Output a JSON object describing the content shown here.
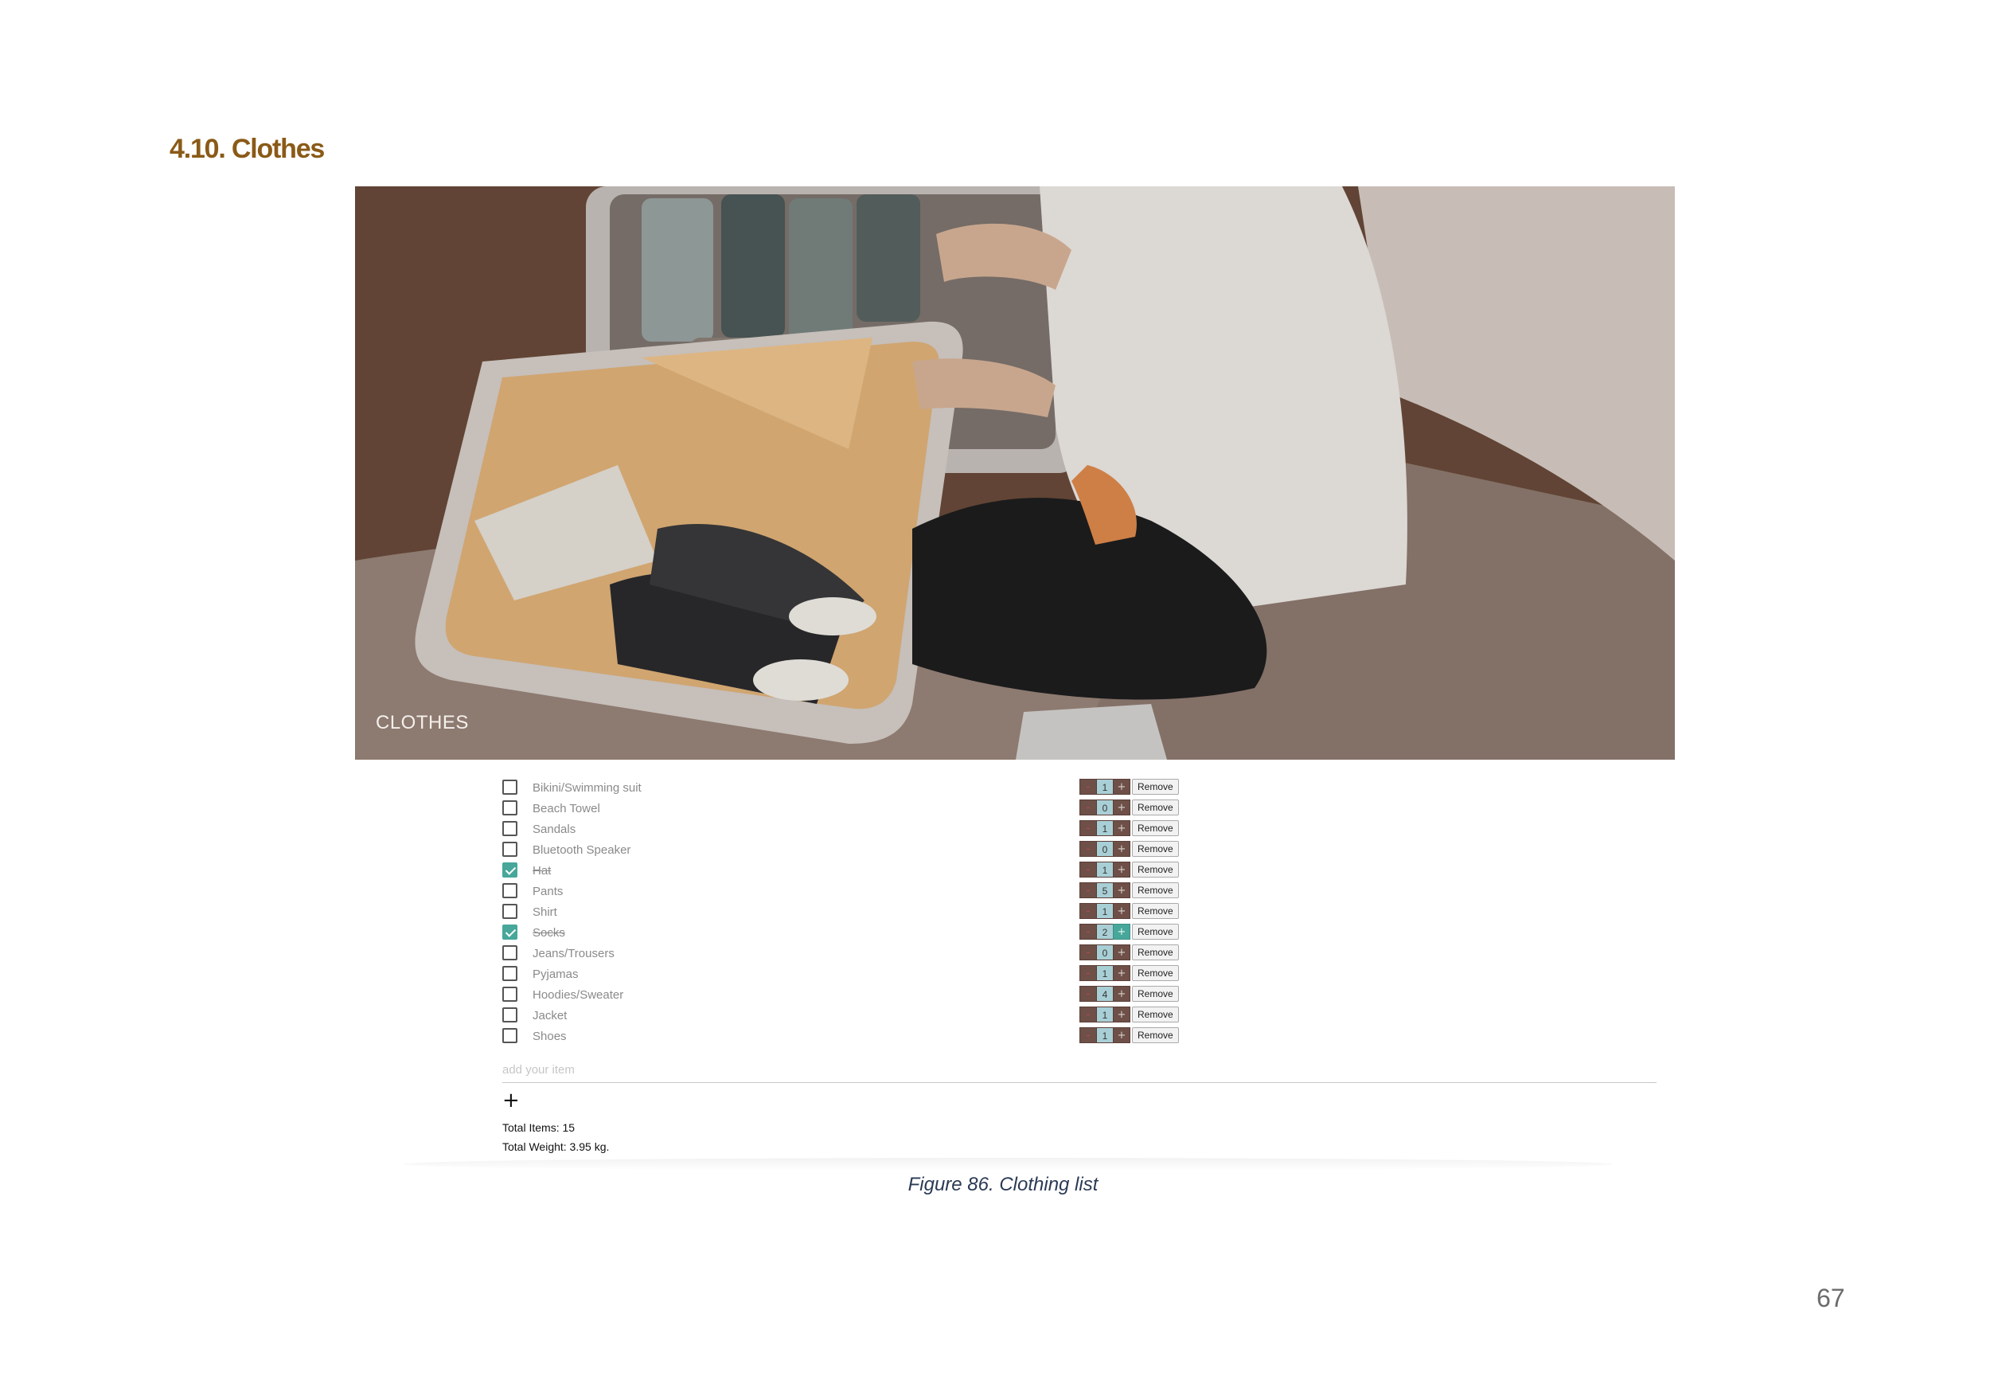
{
  "section": {
    "heading": "4.10. Clothes"
  },
  "hero": {
    "title": "CLOTHES"
  },
  "items": [
    {
      "label": "Bikini/Swimming suit",
      "qty": "1",
      "checked": false
    },
    {
      "label": "Beach Towel",
      "qty": "0",
      "checked": false
    },
    {
      "label": "Sandals",
      "qty": "1",
      "checked": false
    },
    {
      "label": "Bluetooth Speaker",
      "qty": "0",
      "checked": false
    },
    {
      "label": "Hat",
      "qty": "1",
      "checked": true
    },
    {
      "label": "Pants",
      "qty": "5",
      "checked": false
    },
    {
      "label": "Shirt",
      "qty": "1",
      "checked": false
    },
    {
      "label": "Socks",
      "qty": "2",
      "checked": true
    },
    {
      "label": "Jeans/Trousers",
      "qty": "0",
      "checked": false
    },
    {
      "label": "Pyjamas",
      "qty": "1",
      "checked": false
    },
    {
      "label": "Hoodies/Sweater",
      "qty": "4",
      "checked": false
    },
    {
      "label": "Jacket",
      "qty": "1",
      "checked": false
    },
    {
      "label": "Shoes",
      "qty": "1",
      "checked": false
    }
  ],
  "controls": {
    "minus": "-",
    "plus": "+",
    "remove": "Remove"
  },
  "add": {
    "placeholder": "add your item",
    "button": "+"
  },
  "totals": {
    "items": "Total Items: 15",
    "weight": "Total Weight: 3.95 kg."
  },
  "caption": "Figure 86. Clothing list",
  "page_number": "67",
  "colors": {
    "heading": "#8a5a17",
    "accent": "#46a79a",
    "caption": "#2b3a55"
  }
}
